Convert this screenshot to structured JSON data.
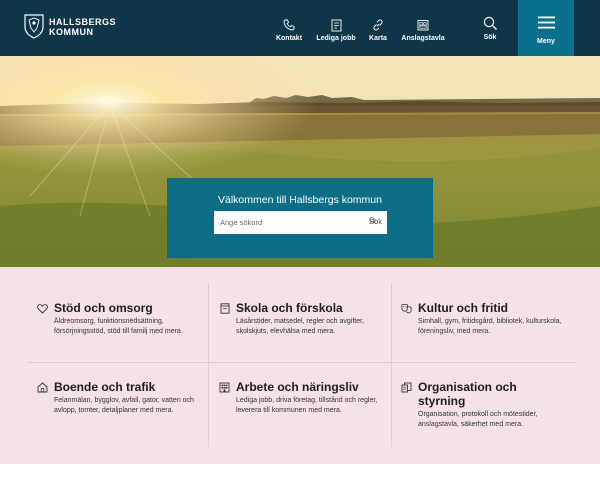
{
  "header": {
    "logo_line1": "HALLSBERGS",
    "logo_line2": "KOMMUN",
    "nav": [
      {
        "label": "Kontakt",
        "icon": "phone-icon"
      },
      {
        "label": "Lediga jobb",
        "icon": "document-icon"
      },
      {
        "label": "Karta",
        "icon": "link-icon"
      },
      {
        "label": "Anslagstavla",
        "icon": "notice-board-icon"
      }
    ],
    "search_label": "Sök",
    "menu_label": "Meny"
  },
  "hero": {
    "title": "Välkommen till Hallsbergs kommun",
    "search_placeholder": "Ange sökord",
    "search_button": "Sök"
  },
  "categories": [
    {
      "title": "Stöd och omsorg",
      "icon": "heart-icon",
      "description": "Äldreomsorg, funktionsnedsättning, försörjningsstöd, stöd till familj med mera."
    },
    {
      "title": "Skola och förskola",
      "icon": "book-icon",
      "description": "Läsårstider, matsedel, regler och avgifter, skolskjuts, elevhälsa med mera."
    },
    {
      "title": "Kultur och fritid",
      "icon": "masks-icon",
      "description": "Simhall, gym, fritidsgård, bibliotek, kulturskola, föreningsliv, med mera."
    },
    {
      "title": "Boende och trafik",
      "icon": "house-icon",
      "description": "Felanmälan, bygglov, avfall, gator, vatten och avlopp, tomter, detaljplaner med mera."
    },
    {
      "title": "Arbete och näringsliv",
      "icon": "building-icon",
      "description": "Lediga jobb, driva företag, tillstånd och regler, leverera till kommunen med mera."
    },
    {
      "title": "Organisation och styrning",
      "icon": "organisation-icon",
      "description": "Organisation, protokoll och mötestider, anslagstavla, säkerhet med mera."
    }
  ],
  "colors": {
    "header_bg": "#0e3548",
    "menu_bg": "#0a6f8c",
    "welcome_bg": "#0d6d87",
    "categories_bg": "#f4e2e6"
  }
}
